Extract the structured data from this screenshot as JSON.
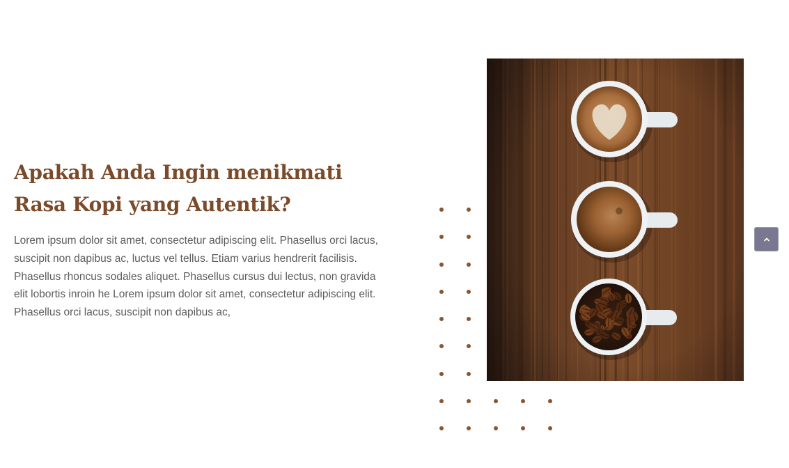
{
  "section": {
    "heading": "Apakah Anda Ingin menikmati Rasa Kopi yang Autentik?",
    "paragraph": "Lorem ipsum dolor sit amet, consectetur adipiscing elit. Phasellus orci lacus, suscipit non dapibus ac, luctus vel tellus. Etiam varius hendrerit facilisis. Phasellus rhoncus sodales aliquet. Phasellus cursus dui lectus, non gravida elit lobortis inroin he Lorem ipsum dolor sit amet, consectetur adipiscing elit. Phasellus orci lacus, suscipit non dapibus ac,"
  },
  "image": {
    "icon": "coffee-cups-photo"
  },
  "scroll_top": {
    "icon": "chevron-up-icon"
  },
  "colors": {
    "heading": "#7a4a2a",
    "body_text": "#5c5c5c",
    "dots": "#8a5530",
    "scroll_button": "#7a7890"
  }
}
